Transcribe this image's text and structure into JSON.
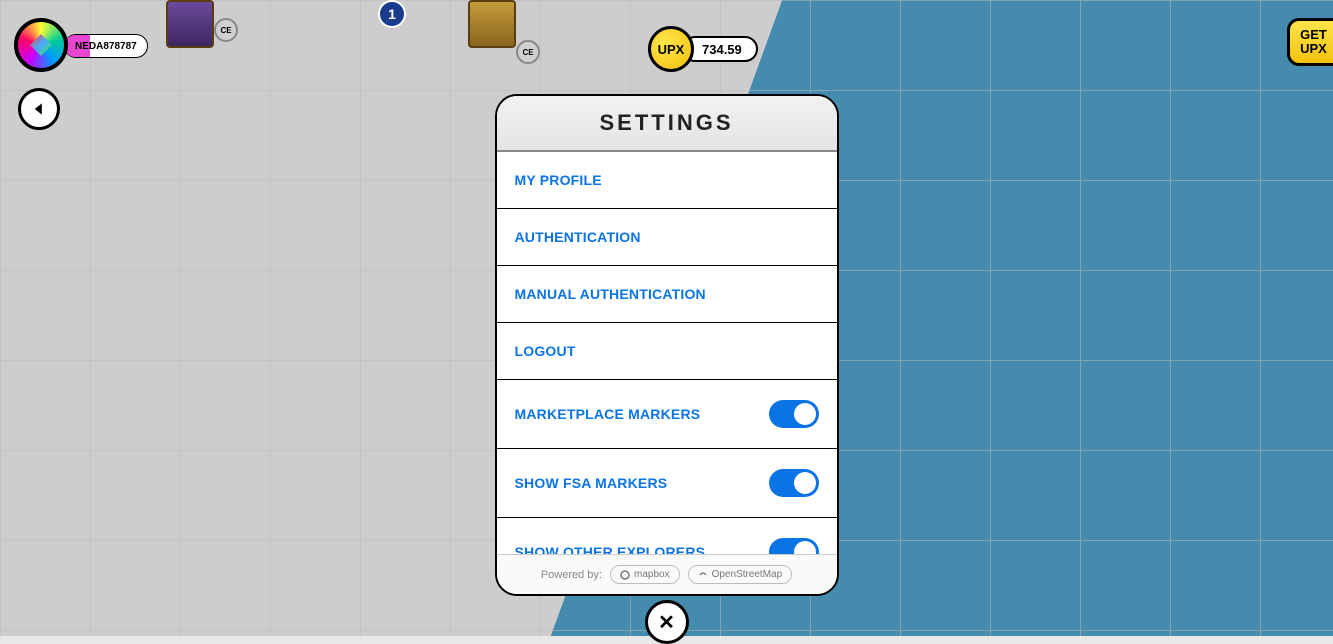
{
  "user": {
    "name": "NEDA878787"
  },
  "balance": {
    "currency_label": "UPX",
    "amount": "734.59"
  },
  "get_upx": {
    "line1": "GET",
    "line2": "UPX"
  },
  "badge_count": "1",
  "ce_label": "CE",
  "panel": {
    "title": "SETTINGS",
    "items": [
      {
        "label": "MY PROFILE",
        "has_toggle": false
      },
      {
        "label": "AUTHENTICATION",
        "has_toggle": false
      },
      {
        "label": "MANUAL AUTHENTICATION",
        "has_toggle": false
      },
      {
        "label": "LOGOUT",
        "has_toggle": false
      },
      {
        "label": "MARKETPLACE MARKERS",
        "has_toggle": true
      },
      {
        "label": "SHOW FSA MARKERS",
        "has_toggle": true
      },
      {
        "label": "SHOW OTHER EXPLORERS",
        "has_toggle": true
      }
    ],
    "footer": {
      "powered_by": "Powered by:",
      "mapbox": "mapbox",
      "osm": "OpenStreetMap"
    }
  },
  "close_glyph": "✕"
}
